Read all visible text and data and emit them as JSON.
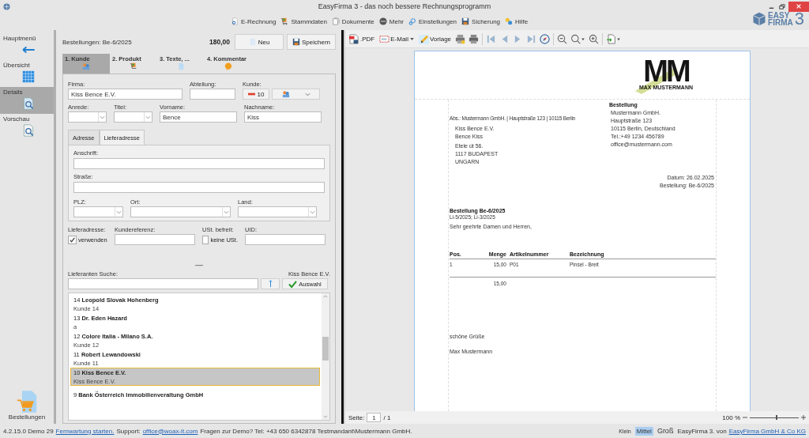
{
  "window": {
    "title": "EasyFirma 3 - das noch bessere Rechnungsprogramm"
  },
  "menu": [
    "E-Rechnung",
    "Stammdaten",
    "Dokumente",
    "Mehr",
    "Einstellungen",
    "Sicherung",
    "Hilfe"
  ],
  "logo": {
    "line1": "EASY",
    "line2": "FIRMA",
    "mark": "3"
  },
  "sidebar": {
    "items": [
      {
        "label": "Hauptmenü",
        "selected": false
      },
      {
        "label": "Übersicht",
        "selected": false
      },
      {
        "label": "Details",
        "selected": true
      },
      {
        "label": "Vorschau",
        "selected": false
      }
    ],
    "bottom": "Bestellungen"
  },
  "form": {
    "heading": "Bestellungen: Be-6/2025",
    "total": "180,00",
    "buttons": [
      "Neu",
      "Speichern"
    ],
    "tabs": [
      {
        "label": "1. Kunde",
        "selected": true
      },
      {
        "label": "2. Produkt",
        "selected": false
      },
      {
        "label": "3. Texte, ...",
        "selected": false
      },
      {
        "label": "4. Kommentar",
        "selected": false
      }
    ],
    "firma": {
      "label": "Firma:",
      "value": "Kiss Bence E.V."
    },
    "abteilung": {
      "label": "Abteilung:"
    },
    "kunde": {
      "label": "Kunde:",
      "number": "10"
    },
    "anrede": {
      "label": "Anrede:"
    },
    "titel": {
      "label": "Titel:"
    },
    "vorname": {
      "label": "Vorname:",
      "value": "Bence"
    },
    "nachname": {
      "label": "Nachname:",
      "value": "Kiss"
    },
    "address_tabs": [
      {
        "label": "Adresse",
        "selected": false
      },
      {
        "label": "Lieferadresse",
        "selected": true
      }
    ],
    "anschrift": {
      "label": "Anschrift:"
    },
    "strasse": {
      "label": "Straße:"
    },
    "plz": {
      "label": "PLZ:"
    },
    "ort": {
      "label": "Ort:"
    },
    "land": {
      "label": "Land:"
    },
    "lieferadresse": {
      "label": "Lieferadresse:",
      "option": "verwenden",
      "checked": true
    },
    "kundereferenz": {
      "label": "Kundereferenz:"
    },
    "ust": {
      "label": "USt. befreit:",
      "option": "keine USt.",
      "checked": false
    },
    "uid": {
      "label": "UID:"
    },
    "search": {
      "label": "Lieferanten Suche:",
      "current": "Kiss Bence E.V.",
      "button": "Auswahl"
    },
    "suppliers": [
      {
        "number": "14",
        "name": "Leopold Slovak Hohenberg",
        "sub": "Kunde 14",
        "selected": false
      },
      {
        "number": "13",
        "name": "Dr. Eden Hazard",
        "sub": "a",
        "selected": false
      },
      {
        "number": "12",
        "name": "Colore Italia - Milano S.A.",
        "sub": "Kunde 12",
        "selected": false
      },
      {
        "number": "11",
        "name": "Robert Lewandowski",
        "sub": "Kunde 11",
        "selected": false
      },
      {
        "number": "10",
        "name": "Kiss Bence E.V.",
        "sub": "Kiss Bence E.V.",
        "selected": true
      },
      {
        "number": "9",
        "name": "Bank Österreich Immobilienveraltung GmbH",
        "selected": false
      }
    ]
  },
  "preview": {
    "toolbar": [
      ".PDF",
      "E-Mail",
      "Vorlage"
    ],
    "document": {
      "logo_initials": "MM",
      "logo_name": "MAX MUSTERMANN",
      "sender": "Abs.: Mustermann GmbH. | Hauptstraße 123 | 10115 Berlin",
      "recipient": [
        "Kiss Bence E.V.",
        "Bence Kiss"
      ],
      "recipient_address": [
        "Etele út 56.",
        "1117 BUDAPEST",
        "UNGARN"
      ],
      "company_heading": "Bestellung",
      "company": [
        "Mustermann GmbH.",
        "Hauptstraße 123",
        "10115 Berlin, Deutschland",
        "Tel.:+49 1234 456789",
        "office@mustermann.com"
      ],
      "meta": [
        "Datum: 26.02.2025",
        "Bestellung: Be-6/2025"
      ],
      "title": "Bestellung Be-6/2025",
      "reference": "Li-5/2025; Li-3/2025",
      "greeting": "Sehr geehrte Damen und Herren,",
      "columns": [
        "Pos.",
        "Menge",
        "Artikelnummer",
        "Bezeichnung"
      ],
      "rows": [
        [
          "1",
          "15,00",
          "P01",
          "Pinsel - Breit"
        ]
      ],
      "total": "15,00",
      "closing": "schöne Grüße",
      "signature": "Max Mustermann"
    },
    "page_label": "Seite:",
    "page": "1",
    "page_total": "/ 1",
    "zoom": "100 %",
    "zoom_slider": {
      "level": 0.55
    }
  },
  "status_bar": {
    "version": "4.2.15.0 Demo 29",
    "remote_link": "Fernwartung starten.",
    "support_label": "Support:",
    "support_link": "office@woax-it.com",
    "info": "Fragen zur Demo? Tel: +43 650 6342878 Testmandant\\Mustermann GmbH.",
    "sizes": [
      {
        "label": "Klein",
        "selected": false
      },
      {
        "label": "Mittel",
        "selected": true
      },
      {
        "label": "Groß",
        "selected": false
      }
    ],
    "vendor": "EasyFirma 3. von",
    "vendor_link": "EasyFirma GmbH & Co KG"
  }
}
